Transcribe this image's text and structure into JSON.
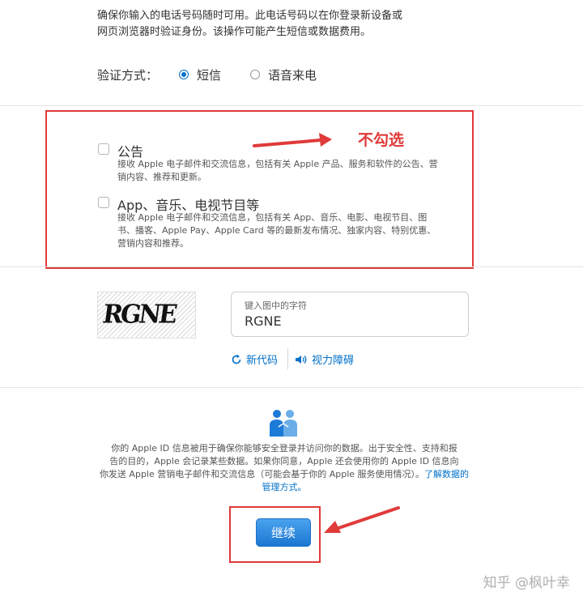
{
  "intro": {
    "line1": "确保你输入的电话号码随时可用。此电话号码以在你登录新设备或",
    "line2": "网页浏览器时验证身份。该操作可能产生短信或数据费用。"
  },
  "verification": {
    "label": "验证方式：",
    "options": [
      {
        "label": "短信",
        "selected": true
      },
      {
        "label": "语音来电",
        "selected": false
      }
    ]
  },
  "annotation": {
    "text": "不勾选",
    "color": "#e03a3a"
  },
  "subscriptions": [
    {
      "title": "公告",
      "checked": false,
      "desc1": "接收 Apple 电子邮件和交流信息，包括有关 Apple 产品、服务和软件的公告、营",
      "desc2": "销内容、推荐和更新。"
    },
    {
      "title": "App、音乐、电视节目等",
      "checked": false,
      "desc1": "接收 Apple 电子邮件和交流信息，包括有关 App、音乐、电影、电视节目、图",
      "desc2": "书、播客、Apple Pay、Apple Card 等的最新发布情况、独家内容、特别优惠、",
      "desc3": "营销内容和推荐。"
    }
  ],
  "captcha": {
    "image_text": "RGNE",
    "field_label": "键入图中的字符",
    "field_value": "RGNE",
    "new_code": "新代码",
    "vision_impaired": "视力障碍"
  },
  "privacy": {
    "line1": "你的 Apple ID 信息被用于确保你能够安全登录并访问你的数据。出于安全性、支持和报",
    "line2": "告的目的，Apple 会记录某些数据。如果你同意，Apple 还会使用你的 Apple ID 信息向",
    "line3": "你发送 Apple 营销电子邮件和交流信息（可能会基于你的 Apple 服务使用情况）。",
    "link": "了解数据的管理方式。"
  },
  "continue_button": "继续",
  "watermark": "知乎 @枫叶幸",
  "colors": {
    "accent": "#0070c9",
    "annotation_red": "#e03a3a"
  }
}
